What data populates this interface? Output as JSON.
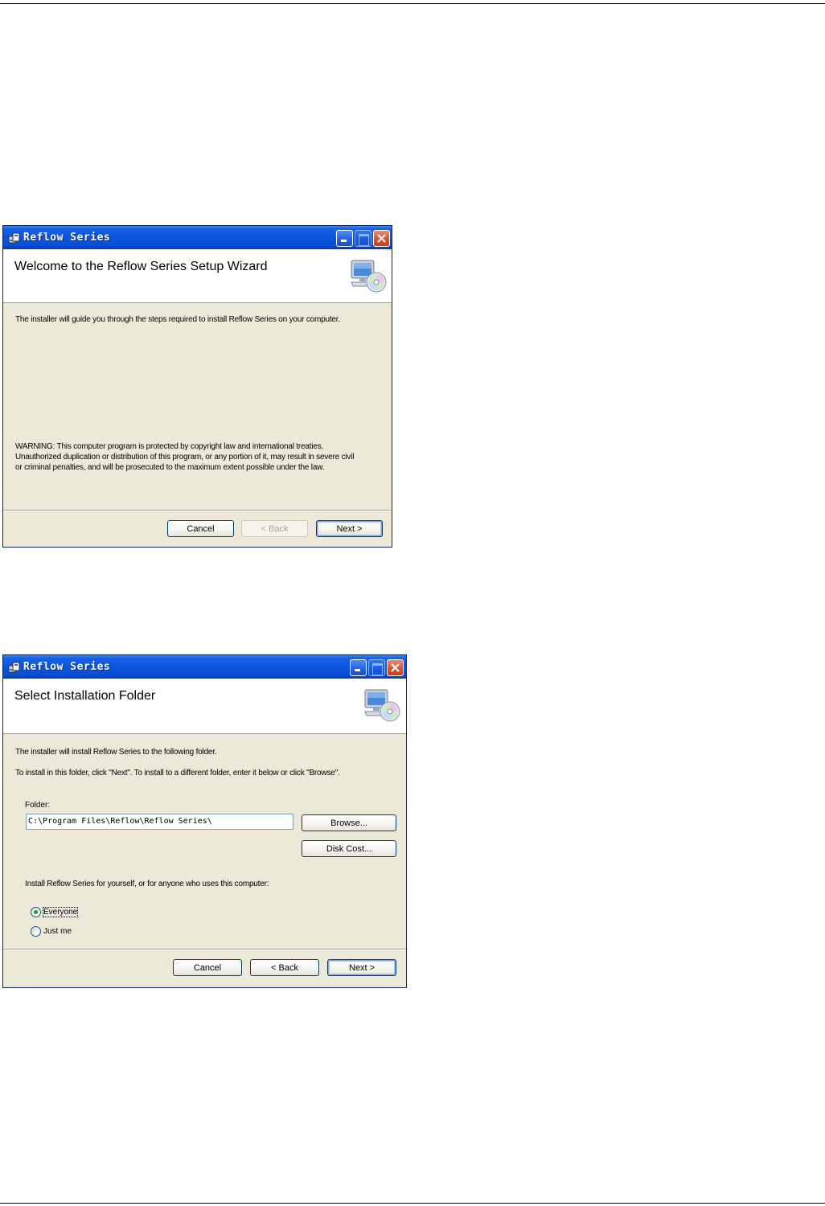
{
  "dialogs": [
    {
      "title": "Reflow Series",
      "heading": "Welcome to the Reflow Series Setup Wizard",
      "intro": "The installer will guide you through the steps required to install Reflow Series on your computer.",
      "warning_lines": [
        "WARNING: This computer program is protected by copyright law and international treaties.",
        "Unauthorized duplication or distribution of this program, or any portion of it, may result in severe civil",
        "or criminal penalties, and will be prosecuted to the maximum extent possible under the law."
      ],
      "buttons": {
        "cancel": "Cancel",
        "back": "< Back",
        "next": "Next >"
      },
      "back_enabled": false
    },
    {
      "title": "Reflow Series",
      "heading": "Select Installation Folder",
      "line1": "The installer will install Reflow Series to the following folder.",
      "line2": "To install in this folder, click \"Next\". To install to a different folder, enter it below or click \"Browse\".",
      "folder_label": "Folder:",
      "folder_value": "C:\\Program Files\\Reflow\\Reflow Series\\",
      "browse": "Browse...",
      "disk_cost": "Disk Cost...",
      "install_for": "Install Reflow Series for yourself, or for anyone who uses this computer:",
      "radio_everyone": "Everyone",
      "radio_just_me": "Just me",
      "selected_option": "Everyone",
      "buttons": {
        "cancel": "Cancel",
        "back": "< Back",
        "next": "Next >"
      },
      "back_enabled": true
    }
  ],
  "colors": {
    "titlebar": "#0b55df",
    "dialog_bg": "#ece9d8",
    "close_button": "#d9552f",
    "radio_dot": "#21a121"
  },
  "icons": [
    "installer-app-icon",
    "minimize-icon",
    "maximize-icon",
    "close-icon",
    "computer-cd-setup-icon"
  ]
}
